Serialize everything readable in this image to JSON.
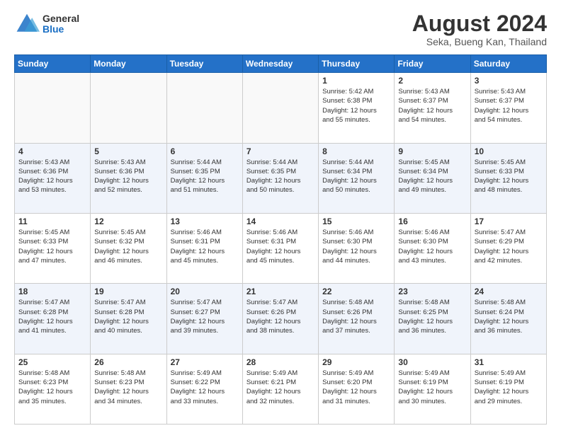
{
  "header": {
    "logo_line1": "General",
    "logo_line2": "Blue",
    "month_year": "August 2024",
    "location": "Seka, Bueng Kan, Thailand"
  },
  "days_of_week": [
    "Sunday",
    "Monday",
    "Tuesday",
    "Wednesday",
    "Thursday",
    "Friday",
    "Saturday"
  ],
  "weeks": [
    [
      {
        "day": "",
        "info": ""
      },
      {
        "day": "",
        "info": ""
      },
      {
        "day": "",
        "info": ""
      },
      {
        "day": "",
        "info": ""
      },
      {
        "day": "1",
        "info": "Sunrise: 5:42 AM\nSunset: 6:38 PM\nDaylight: 12 hours\nand 55 minutes."
      },
      {
        "day": "2",
        "info": "Sunrise: 5:43 AM\nSunset: 6:37 PM\nDaylight: 12 hours\nand 54 minutes."
      },
      {
        "day": "3",
        "info": "Sunrise: 5:43 AM\nSunset: 6:37 PM\nDaylight: 12 hours\nand 54 minutes."
      }
    ],
    [
      {
        "day": "4",
        "info": "Sunrise: 5:43 AM\nSunset: 6:36 PM\nDaylight: 12 hours\nand 53 minutes."
      },
      {
        "day": "5",
        "info": "Sunrise: 5:43 AM\nSunset: 6:36 PM\nDaylight: 12 hours\nand 52 minutes."
      },
      {
        "day": "6",
        "info": "Sunrise: 5:44 AM\nSunset: 6:35 PM\nDaylight: 12 hours\nand 51 minutes."
      },
      {
        "day": "7",
        "info": "Sunrise: 5:44 AM\nSunset: 6:35 PM\nDaylight: 12 hours\nand 50 minutes."
      },
      {
        "day": "8",
        "info": "Sunrise: 5:44 AM\nSunset: 6:34 PM\nDaylight: 12 hours\nand 50 minutes."
      },
      {
        "day": "9",
        "info": "Sunrise: 5:45 AM\nSunset: 6:34 PM\nDaylight: 12 hours\nand 49 minutes."
      },
      {
        "day": "10",
        "info": "Sunrise: 5:45 AM\nSunset: 6:33 PM\nDaylight: 12 hours\nand 48 minutes."
      }
    ],
    [
      {
        "day": "11",
        "info": "Sunrise: 5:45 AM\nSunset: 6:33 PM\nDaylight: 12 hours\nand 47 minutes."
      },
      {
        "day": "12",
        "info": "Sunrise: 5:45 AM\nSunset: 6:32 PM\nDaylight: 12 hours\nand 46 minutes."
      },
      {
        "day": "13",
        "info": "Sunrise: 5:46 AM\nSunset: 6:31 PM\nDaylight: 12 hours\nand 45 minutes."
      },
      {
        "day": "14",
        "info": "Sunrise: 5:46 AM\nSunset: 6:31 PM\nDaylight: 12 hours\nand 45 minutes."
      },
      {
        "day": "15",
        "info": "Sunrise: 5:46 AM\nSunset: 6:30 PM\nDaylight: 12 hours\nand 44 minutes."
      },
      {
        "day": "16",
        "info": "Sunrise: 5:46 AM\nSunset: 6:30 PM\nDaylight: 12 hours\nand 43 minutes."
      },
      {
        "day": "17",
        "info": "Sunrise: 5:47 AM\nSunset: 6:29 PM\nDaylight: 12 hours\nand 42 minutes."
      }
    ],
    [
      {
        "day": "18",
        "info": "Sunrise: 5:47 AM\nSunset: 6:28 PM\nDaylight: 12 hours\nand 41 minutes."
      },
      {
        "day": "19",
        "info": "Sunrise: 5:47 AM\nSunset: 6:28 PM\nDaylight: 12 hours\nand 40 minutes."
      },
      {
        "day": "20",
        "info": "Sunrise: 5:47 AM\nSunset: 6:27 PM\nDaylight: 12 hours\nand 39 minutes."
      },
      {
        "day": "21",
        "info": "Sunrise: 5:47 AM\nSunset: 6:26 PM\nDaylight: 12 hours\nand 38 minutes."
      },
      {
        "day": "22",
        "info": "Sunrise: 5:48 AM\nSunset: 6:26 PM\nDaylight: 12 hours\nand 37 minutes."
      },
      {
        "day": "23",
        "info": "Sunrise: 5:48 AM\nSunset: 6:25 PM\nDaylight: 12 hours\nand 36 minutes."
      },
      {
        "day": "24",
        "info": "Sunrise: 5:48 AM\nSunset: 6:24 PM\nDaylight: 12 hours\nand 36 minutes."
      }
    ],
    [
      {
        "day": "25",
        "info": "Sunrise: 5:48 AM\nSunset: 6:23 PM\nDaylight: 12 hours\nand 35 minutes."
      },
      {
        "day": "26",
        "info": "Sunrise: 5:48 AM\nSunset: 6:23 PM\nDaylight: 12 hours\nand 34 minutes."
      },
      {
        "day": "27",
        "info": "Sunrise: 5:49 AM\nSunset: 6:22 PM\nDaylight: 12 hours\nand 33 minutes."
      },
      {
        "day": "28",
        "info": "Sunrise: 5:49 AM\nSunset: 6:21 PM\nDaylight: 12 hours\nand 32 minutes."
      },
      {
        "day": "29",
        "info": "Sunrise: 5:49 AM\nSunset: 6:20 PM\nDaylight: 12 hours\nand 31 minutes."
      },
      {
        "day": "30",
        "info": "Sunrise: 5:49 AM\nSunset: 6:19 PM\nDaylight: 12 hours\nand 30 minutes."
      },
      {
        "day": "31",
        "info": "Sunrise: 5:49 AM\nSunset: 6:19 PM\nDaylight: 12 hours\nand 29 minutes."
      }
    ]
  ]
}
